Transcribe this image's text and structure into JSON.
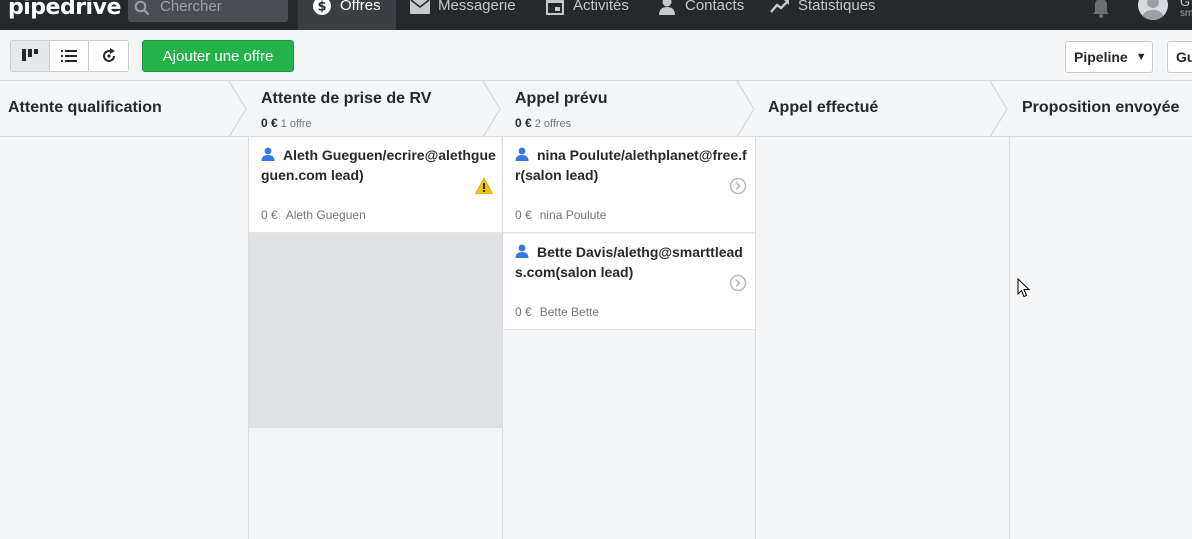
{
  "brand": {
    "logo_text": "pipedrive"
  },
  "topnav": {
    "search_placeholder": "Chercher",
    "items": [
      {
        "label": "Offres",
        "icon": "dollar-icon",
        "active": true
      },
      {
        "label": "Messagerie",
        "icon": "mail-icon",
        "active": false
      },
      {
        "label": "Activités",
        "icon": "calendar-icon",
        "active": false
      },
      {
        "label": "Contacts",
        "icon": "person-icon",
        "active": false
      },
      {
        "label": "Statistiques",
        "icon": "trend-icon",
        "active": false
      }
    ],
    "user_initial": "G",
    "user_sub": "sm"
  },
  "toolbar": {
    "add_button": "Ajouter une offre",
    "pipeline_select": "Pipeline",
    "user_select": "Gu"
  },
  "stages": [
    {
      "name": "Attente qualification",
      "amount": "",
      "count": ""
    },
    {
      "name": "Attente de prise de RV",
      "amount": "0 €",
      "count": "1 offre"
    },
    {
      "name": "Appel prévu",
      "amount": "0 €",
      "count": "2 offres"
    },
    {
      "name": "Appel effectué",
      "amount": "",
      "count": ""
    },
    {
      "name": "Proposition envoyée",
      "amount": "",
      "count": ""
    }
  ],
  "deals": {
    "col2": [
      {
        "title": "Aleth Gueguen/ecrire@alethgueguen.com lead)",
        "value": "0 €",
        "person": "Aleth Gueguen",
        "status": "warning-icon"
      }
    ],
    "col3": [
      {
        "title": "nina Poulute/alethplanet@free.fr(salon lead)",
        "value": "0 €",
        "person": "nina Poulute",
        "status": "next-arrow-icon"
      },
      {
        "title": "Bette Davis/alethg@smarttleads.com(salon lead)",
        "value": "0 €",
        "person": "Bette Bette",
        "status": "next-arrow-icon"
      }
    ]
  },
  "colors": {
    "accent_green": "#26b24b",
    "nav_bg": "#26292c",
    "warning": "#f5c700"
  }
}
